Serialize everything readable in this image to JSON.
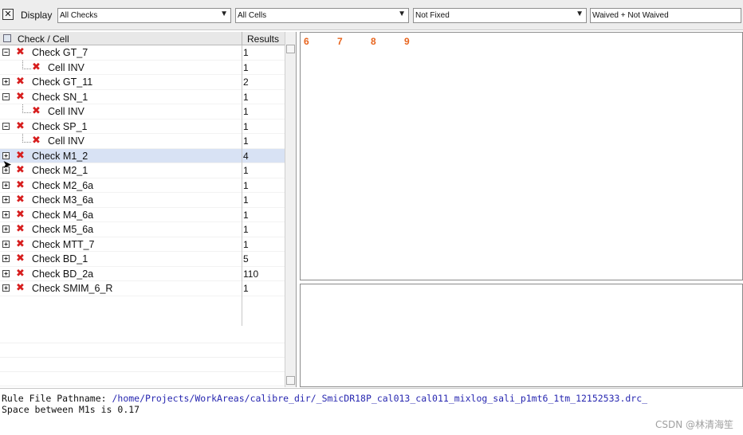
{
  "toolbar": {
    "display_label": "Display",
    "filters": [
      {
        "value": "All Checks"
      },
      {
        "value": "All Cells"
      },
      {
        "value": "Not Fixed"
      },
      {
        "value": "Waived + Not Waived"
      }
    ],
    "dropdown_glyph": "▼"
  },
  "tree": {
    "col_check": "Check / Cell",
    "col_results": "Results",
    "rows": [
      {
        "label": "Check GT_7",
        "count": "1",
        "level": 0,
        "expander": "−",
        "selected": false
      },
      {
        "label": "Cell INV",
        "count": "1",
        "level": 1,
        "expander": "",
        "selected": false
      },
      {
        "label": "Check GT_11",
        "count": "2",
        "level": 0,
        "expander": "+",
        "selected": false
      },
      {
        "label": "Check SN_1",
        "count": "1",
        "level": 0,
        "expander": "−",
        "selected": false
      },
      {
        "label": "Cell INV",
        "count": "1",
        "level": 1,
        "expander": "",
        "selected": false
      },
      {
        "label": "Check SP_1",
        "count": "1",
        "level": 0,
        "expander": "−",
        "selected": false
      },
      {
        "label": "Cell INV",
        "count": "1",
        "level": 1,
        "expander": "",
        "selected": false
      },
      {
        "label": "Check M1_2",
        "count": "4",
        "level": 0,
        "expander": "+",
        "selected": true
      },
      {
        "label": "Check M2_1",
        "count": "1",
        "level": 0,
        "expander": "+",
        "selected": false
      },
      {
        "label": "Check M2_6a",
        "count": "1",
        "level": 0,
        "expander": "+",
        "selected": false
      },
      {
        "label": "Check M3_6a",
        "count": "1",
        "level": 0,
        "expander": "+",
        "selected": false
      },
      {
        "label": "Check M4_6a",
        "count": "1",
        "level": 0,
        "expander": "+",
        "selected": false
      },
      {
        "label": "Check M5_6a",
        "count": "1",
        "level": 0,
        "expander": "+",
        "selected": false
      },
      {
        "label": "Check MTT_7",
        "count": "1",
        "level": 0,
        "expander": "+",
        "selected": false
      },
      {
        "label": "Check BD_1",
        "count": "5",
        "level": 0,
        "expander": "+",
        "selected": false
      },
      {
        "label": "Check BD_2a",
        "count": "110",
        "level": 0,
        "expander": "+",
        "selected": false
      },
      {
        "label": "Check SMIM_6_R",
        "count": "1",
        "level": 0,
        "expander": "+",
        "selected": false
      }
    ]
  },
  "results_view": {
    "ruler_numbers": [
      "6",
      "7",
      "8",
      "9"
    ],
    "ruler_color": "#e8641d"
  },
  "info": {
    "rule_file_label": "Rule File Pathname: ",
    "rule_file_path": "/home/Projects/WorkAreas/calibre_dir/_SmicDR18P_cal013_cal011_mixlog_sali_p1mt6_1tm_12152533.drc_",
    "description": "Space between M1s is 0.17"
  },
  "watermark": "CSDN @林清海笙",
  "icons": {
    "close": "close-icon",
    "error": "error-x-icon",
    "expand": "expand-icon",
    "collapse": "collapse-icon",
    "cursor": "mouse-pointer-icon"
  }
}
